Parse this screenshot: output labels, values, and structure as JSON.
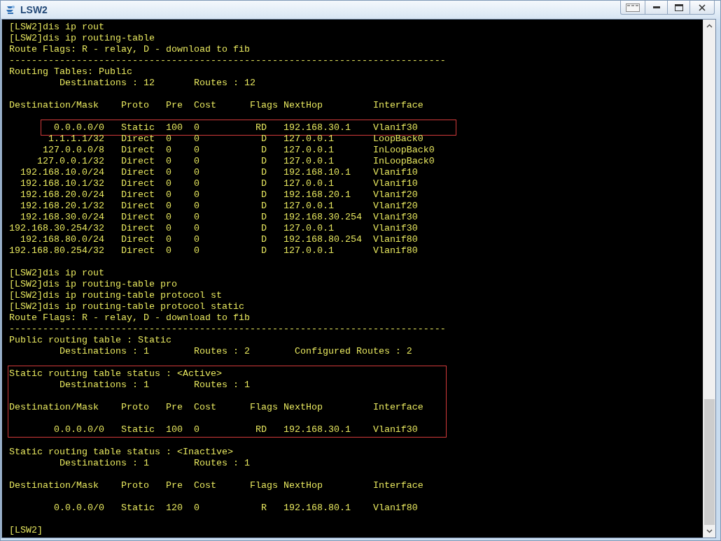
{
  "window": {
    "title": "LSW2"
  },
  "terminal": {
    "blocks": [
      {
        "boxed": false,
        "lines": [
          {
            "text": "[LSW2]dis ip rout",
            "gap_before": false
          },
          {
            "text": "[LSW2]dis ip routing-table",
            "gap_before": false
          },
          {
            "text": "Route Flags: R - relay, D - download to fib",
            "gap_before": false
          },
          {
            "text": "------------------------------------------------------------------------------",
            "gap_before": false
          },
          {
            "text": "Routing Tables: Public",
            "gap_before": false
          },
          {
            "text": "         Destinations : 12       Routes : 12",
            "gap_before": false
          },
          {
            "text": "Destination/Mask    Proto   Pre  Cost      Flags NextHop         Interface",
            "gap_before": true
          }
        ]
      },
      {
        "boxed": true,
        "lines": [
          {
            "text": "        0.0.0.0/0   Static  100  0          RD   192.168.30.1    Vlanif30",
            "gap_before": true
          }
        ]
      },
      {
        "boxed": false,
        "lines": [
          {
            "text": "       1.1.1.1/32   Direct  0    0           D   127.0.0.1       LoopBack0",
            "gap_before": false
          },
          {
            "text": "      127.0.0.0/8   Direct  0    0           D   127.0.0.1       InLoopBack0",
            "gap_before": false
          },
          {
            "text": "     127.0.0.1/32   Direct  0    0           D   127.0.0.1       InLoopBack0",
            "gap_before": false
          },
          {
            "text": "  192.168.10.0/24   Direct  0    0           D   192.168.10.1    Vlanif10",
            "gap_before": false
          },
          {
            "text": "  192.168.10.1/32   Direct  0    0           D   127.0.0.1       Vlanif10",
            "gap_before": false
          },
          {
            "text": "  192.168.20.0/24   Direct  0    0           D   192.168.20.1    Vlanif20",
            "gap_before": false
          },
          {
            "text": "  192.168.20.1/32   Direct  0    0           D   127.0.0.1       Vlanif20",
            "gap_before": false
          },
          {
            "text": "  192.168.30.0/24   Direct  0    0           D   192.168.30.254  Vlanif30",
            "gap_before": false
          },
          {
            "text": "192.168.30.254/32   Direct  0    0           D   127.0.0.1       Vlanif30",
            "gap_before": false
          },
          {
            "text": "  192.168.80.0/24   Direct  0    0           D   192.168.80.254  Vlanif80",
            "gap_before": false
          },
          {
            "text": "192.168.80.254/32   Direct  0    0           D   127.0.0.1       Vlanif80",
            "gap_before": false
          },
          {
            "text": "[LSW2]dis ip rout",
            "gap_before": true
          },
          {
            "text": "[LSW2]dis ip routing-table pro",
            "gap_before": false
          },
          {
            "text": "[LSW2]dis ip routing-table protocol st",
            "gap_before": false
          },
          {
            "text": "[LSW2]dis ip routing-table protocol static",
            "gap_before": false
          },
          {
            "text": "Route Flags: R - relay, D - download to fib",
            "gap_before": false
          },
          {
            "text": "------------------------------------------------------------------------------",
            "gap_before": false
          },
          {
            "text": "Public routing table : Static",
            "gap_before": false
          },
          {
            "text": "         Destinations : 1        Routes : 2        Configured Routes : 2",
            "gap_before": false
          }
        ]
      },
      {
        "boxed": true,
        "lines": [
          {
            "text": "Static routing table status : <Active>",
            "gap_before": true
          },
          {
            "text": "         Destinations : 1        Routes : 1",
            "gap_before": false
          },
          {
            "text": "Destination/Mask    Proto   Pre  Cost      Flags NextHop         Interface",
            "gap_before": true
          },
          {
            "text": "        0.0.0.0/0   Static  100  0          RD   192.168.30.1    Vlanif30",
            "gap_before": true
          }
        ]
      },
      {
        "boxed": false,
        "lines": [
          {
            "text": "Static routing table status : <Inactive>",
            "gap_before": true
          },
          {
            "text": "         Destinations : 1        Routes : 1",
            "gap_before": false
          },
          {
            "text": "Destination/Mask    Proto   Pre  Cost      Flags NextHop         Interface",
            "gap_before": true
          },
          {
            "text": "        0.0.0.0/0   Static  120  0           R   192.168.80.1    Vlanif80",
            "gap_before": true
          },
          {
            "text": "[LSW2]",
            "gap_before": true
          }
        ]
      }
    ]
  }
}
